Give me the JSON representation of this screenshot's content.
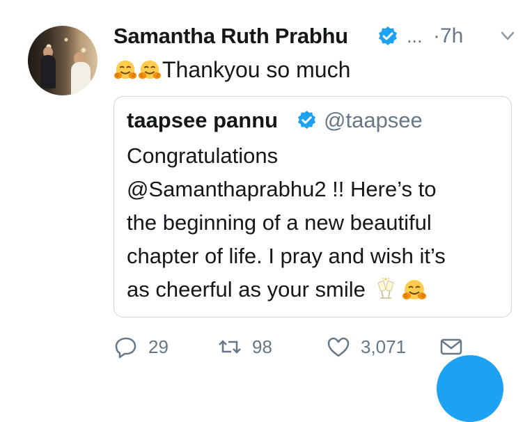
{
  "tweet": {
    "author_name": "Samantha Ruth Prabhu",
    "ellipsis": "...",
    "time_sep": "·",
    "time": "7h",
    "text": "Thankyou so much",
    "emojis": [
      "hugging-face",
      "hugging-face"
    ]
  },
  "quoted": {
    "author_name": "taapsee pannu",
    "handle": "@taapsee",
    "lines": [
      "Congratulations",
      "@Samanthaprabhu2 !! Here’s to",
      "the beginning of a new beautiful",
      "chapter of life. I pray and wish it’s",
      "as cheerful as your smile"
    ],
    "trailing_emojis": [
      "clinking-glasses",
      "hugging-face"
    ]
  },
  "actions": {
    "reply_count": "29",
    "retweet_count": "98",
    "like_count": "3,071"
  },
  "colors": {
    "verified": "#1da1f2",
    "muted": "#657786",
    "border": "#ccd6dd",
    "fab": "#1da1f2"
  }
}
